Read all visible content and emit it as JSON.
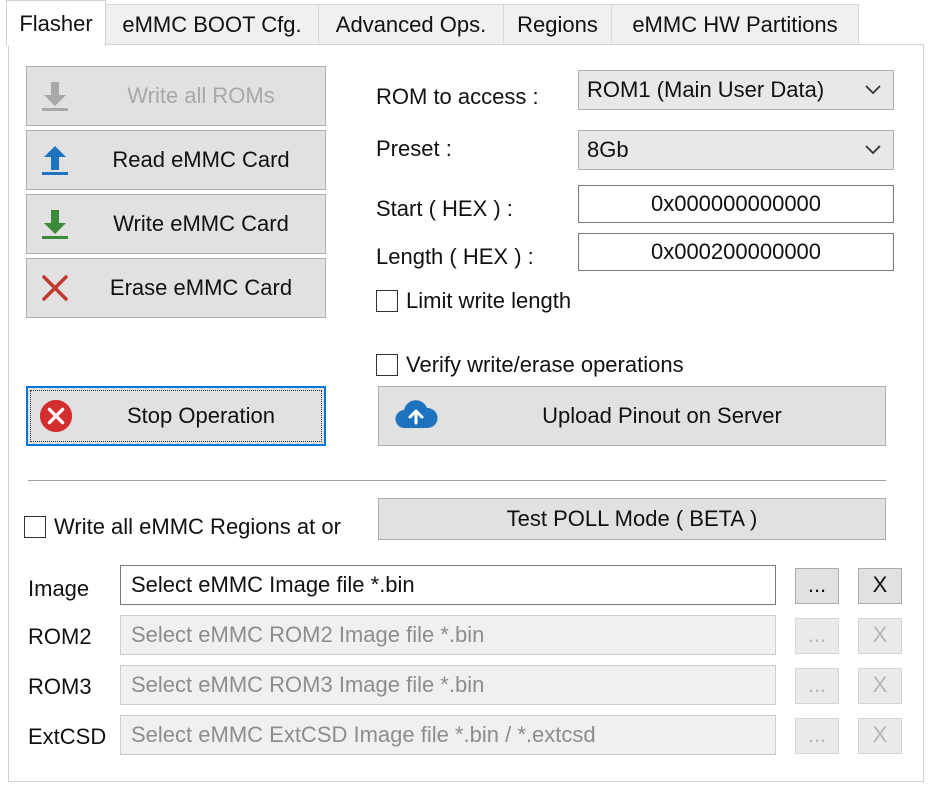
{
  "tabs": [
    "Flasher",
    "eMMC BOOT Cfg.",
    "Advanced Ops.",
    "Regions",
    "eMMC HW Partitions"
  ],
  "buttons": {
    "write_all_roms": "Write all ROMs",
    "read_emmc": "Read eMMC Card",
    "write_emmc": "Write eMMC Card",
    "erase_emmc": "Erase eMMC Card",
    "stop": "Stop Operation",
    "upload_pinout": "Upload Pinout on Server",
    "test_poll": "Test POLL Mode ( BETA )"
  },
  "fields": {
    "rom_to_access_label": "ROM to access :",
    "rom_to_access_value": "ROM1 (Main User Data)",
    "preset_label": "Preset :",
    "preset_value": "8Gb",
    "start_label": "Start ( HEX ) :",
    "start_value": "0x000000000000",
    "length_label": "Length ( HEX ) :",
    "length_value": "0x000200000000"
  },
  "checkboxes": {
    "limit_write_length": "Limit write length",
    "verify_ops": "Verify write/erase operations",
    "write_all_regions": "Write all eMMC Regions at or"
  },
  "files": [
    {
      "label": "Image",
      "value": "Select eMMC Image file *.bin",
      "browse": "...",
      "clear": "X"
    },
    {
      "label": "ROM2",
      "value": "Select eMMC ROM2 Image file *.bin",
      "browse": "...",
      "clear": "X"
    },
    {
      "label": "ROM3",
      "value": "Select eMMC ROM3 Image file *.bin",
      "browse": "...",
      "clear": "X"
    },
    {
      "label": "ExtCSD",
      "value": "Select eMMC ExtCSD Image file *.bin / *.extcsd",
      "browse": "...",
      "clear": "X"
    }
  ],
  "colors": {
    "accent": "#0078d7",
    "upload_blue": "#1e73be",
    "download_green": "#3a8a3a",
    "erase_red": "#c0392b",
    "stop_red": "#d32f2f"
  },
  "icons": {
    "write_all_roms": "download-arrow-icon",
    "read_emmc": "upload-arrow-icon",
    "write_emmc": "download-arrow-icon",
    "erase_emmc": "x-icon",
    "stop": "stop-circle-icon",
    "upload_pinout": "cloud-upload-icon"
  }
}
